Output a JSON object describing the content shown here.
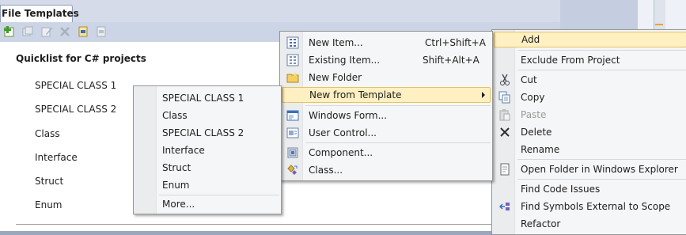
{
  "tool_window": {
    "tab_title": "File Templates",
    "toolbar_icons": [
      "add-template-icon",
      "duplicate-icon",
      "edit-icon",
      "delete-icon",
      "import-icon",
      "export-icon"
    ],
    "quicklist_title": "Quicklist for C# projects",
    "quicklist_items": [
      "SPECIAL CLASS 1",
      "SPECIAL CLASS 2",
      "Class",
      "Interface",
      "Struct",
      "Enum"
    ]
  },
  "template_submenu": {
    "items": [
      "SPECIAL CLASS 1",
      "Class",
      "SPECIAL CLASS 2",
      "Interface",
      "Struct",
      "Enum"
    ],
    "more_label": "More..."
  },
  "add_submenu": {
    "items": [
      {
        "label": "New Item...",
        "shortcut": "Ctrl+Shift+A",
        "icon": "new-item-icon"
      },
      {
        "label": "Existing Item...",
        "shortcut": "Shift+Alt+A",
        "icon": "existing-item-icon"
      },
      {
        "label": "New Folder",
        "shortcut": "",
        "icon": "folder-icon"
      },
      {
        "label": "New from Template",
        "shortcut": "",
        "icon": "",
        "has_submenu": true,
        "highlighted": true
      },
      {
        "label": "Windows Form...",
        "shortcut": "",
        "icon": "windows-form-icon"
      },
      {
        "label": "User Control...",
        "shortcut": "",
        "icon": "user-control-icon"
      },
      {
        "label": "Component...",
        "shortcut": "",
        "icon": "component-icon"
      },
      {
        "label": "Class...",
        "shortcut": "",
        "icon": "class-icon"
      }
    ]
  },
  "context_menu": {
    "items": [
      {
        "label": "Add",
        "icon": "",
        "highlighted": true
      },
      {
        "label": "Exclude From Project",
        "icon": ""
      },
      {
        "label": "Cut",
        "icon": "cut-icon"
      },
      {
        "label": "Copy",
        "icon": "copy-icon"
      },
      {
        "label": "Paste",
        "icon": "paste-icon",
        "disabled": true
      },
      {
        "label": "Delete",
        "icon": "delete-icon"
      },
      {
        "label": "Rename",
        "icon": ""
      },
      {
        "label": "Open Folder in Windows Explorer",
        "icon": "open-folder-icon"
      },
      {
        "label": "Find Code Issues",
        "icon": ""
      },
      {
        "label": "Find Symbols External to Scope",
        "icon": "find-symbols-icon"
      },
      {
        "label": "Refactor",
        "icon": ""
      }
    ]
  },
  "colors": {
    "menu_highlight": "#fff0c2",
    "menu_highlight_border": "#e5c365",
    "tab_strip": "#d6dbe9",
    "toolbar": "#ccd5e6"
  }
}
